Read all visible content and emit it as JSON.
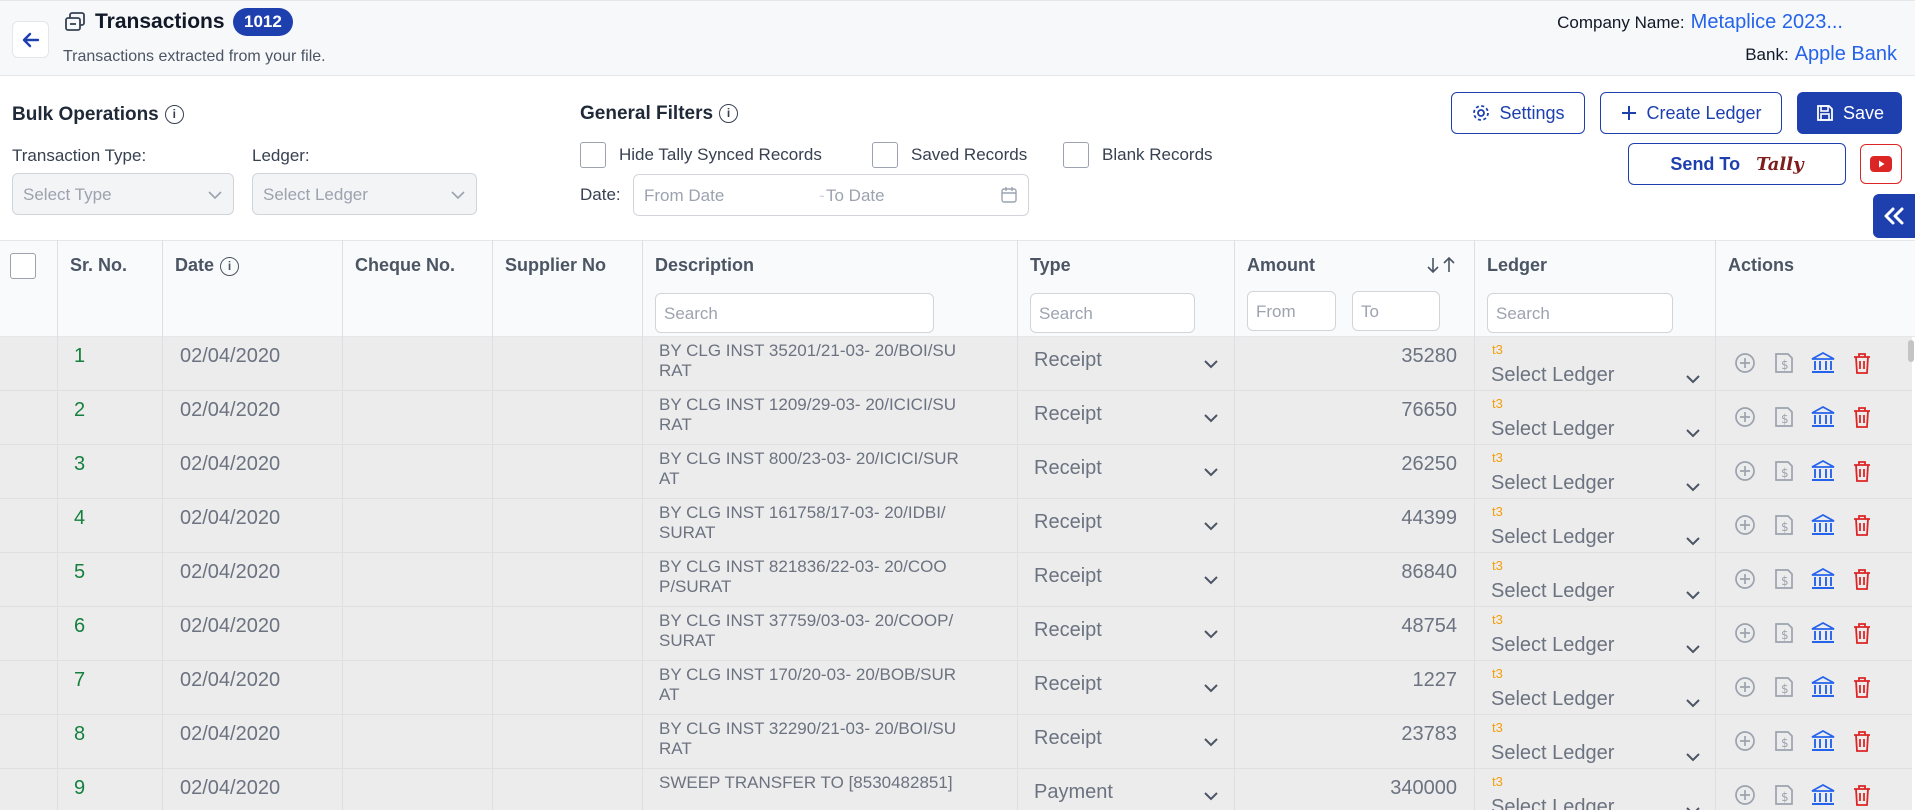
{
  "header": {
    "title": "Transactions",
    "count_badge": "1012",
    "subtitle": "Transactions extracted from your file.",
    "company_label": "Company Name:",
    "company_value": "Metaplice 2023...",
    "bank_label": "Bank:",
    "bank_value": "Apple Bank"
  },
  "bulk": {
    "heading": "Bulk Operations",
    "type_label": "Transaction Type:",
    "type_placeholder": "Select Type",
    "ledger_label": "Ledger:",
    "ledger_placeholder": "Select Ledger"
  },
  "filters": {
    "heading": "General Filters",
    "hide_tally": "Hide Tally Synced Records",
    "saved": "Saved Records",
    "blank": "Blank Records",
    "date_label": "Date:",
    "from_date": "From Date",
    "to_date": "To Date"
  },
  "actions": {
    "settings": "Settings",
    "create_ledger": "Create Ledger",
    "save": "Save",
    "send_to": "Send To",
    "tally_logo": "Tally"
  },
  "table": {
    "columns": {
      "sr": "Sr. No.",
      "date": "Date",
      "cheque": "Cheque No.",
      "supplier": "Supplier No",
      "description": "Description",
      "type": "Type",
      "amount": "Amount",
      "ledger": "Ledger",
      "actions": "Actions"
    },
    "search_placeholder": "Search",
    "amount_from": "From",
    "amount_to": "To",
    "ledger_tag": "t3",
    "ledger_placeholder": "Select Ledger",
    "rows": [
      {
        "sr": "1",
        "date": "02/04/2020",
        "desc1": "BY CLG INST 35201/21-03- 20/BOI/SU",
        "desc2": "RAT",
        "type": "Receipt",
        "amount": "35280"
      },
      {
        "sr": "2",
        "date": "02/04/2020",
        "desc1": "BY CLG INST 1209/29-03- 20/ICICI/SU",
        "desc2": "RAT",
        "type": "Receipt",
        "amount": "76650"
      },
      {
        "sr": "3",
        "date": "02/04/2020",
        "desc1": "BY CLG INST 800/23-03- 20/ICICI/SUR",
        "desc2": "AT",
        "type": "Receipt",
        "amount": "26250"
      },
      {
        "sr": "4",
        "date": "02/04/2020",
        "desc1": "BY CLG INST 161758/17-03- 20/IDBI/",
        "desc2": "SURAT",
        "type": "Receipt",
        "amount": "44399"
      },
      {
        "sr": "5",
        "date": "02/04/2020",
        "desc1": "BY CLG INST 821836/22-03- 20/COO",
        "desc2": "P/SURAT",
        "type": "Receipt",
        "amount": "86840"
      },
      {
        "sr": "6",
        "date": "02/04/2020",
        "desc1": "BY CLG INST 37759/03-03- 20/COOP/",
        "desc2": "SURAT",
        "type": "Receipt",
        "amount": "48754"
      },
      {
        "sr": "7",
        "date": "02/04/2020",
        "desc1": "BY CLG INST 170/20-03- 20/BOB/SUR",
        "desc2": "AT",
        "type": "Receipt",
        "amount": "1227"
      },
      {
        "sr": "8",
        "date": "02/04/2020",
        "desc1": "BY CLG INST 32290/21-03- 20/BOI/SU",
        "desc2": "RAT",
        "type": "Receipt",
        "amount": "23783"
      },
      {
        "sr": "9",
        "date": "02/04/2020",
        "desc1": "SWEEP TRANSFER TO [8530482851]",
        "desc2": "",
        "type": "Payment",
        "amount": "340000"
      }
    ]
  }
}
